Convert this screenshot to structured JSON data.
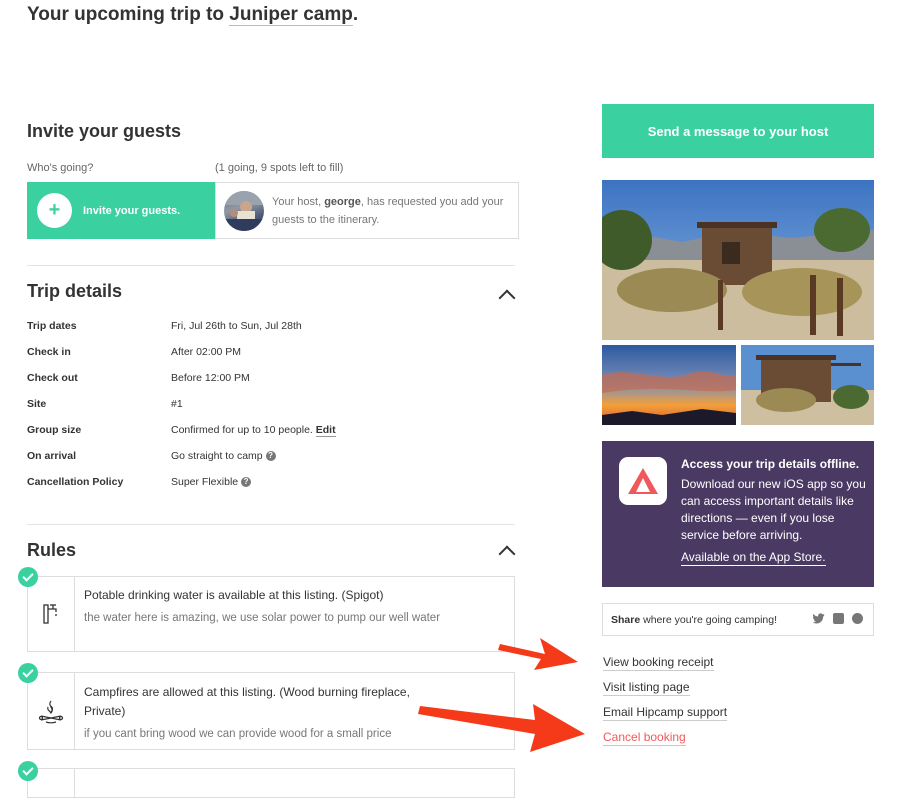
{
  "header": {
    "title_prefix": "Your upcoming trip to ",
    "camp_name": "Juniper camp",
    "title_suffix": "."
  },
  "invite": {
    "heading": "Invite your guests",
    "whos_going_label": "Who's going?",
    "count_text": "(1 going, 9 spots left to fill)",
    "button_label": "Invite your guests.",
    "host_text_pre": "Your host, ",
    "host_name": "george",
    "host_text_post": ", has requested you add your guests to the itinerary."
  },
  "trip_details": {
    "heading": "Trip details",
    "rows": [
      {
        "label": "Trip dates",
        "value": "Fri, Jul 26th to Sun, Jul 28th"
      },
      {
        "label": "Check in",
        "value": "After 02:00 PM"
      },
      {
        "label": "Check out",
        "value": "Before 12:00 PM"
      },
      {
        "label": "Site",
        "value": "#1"
      },
      {
        "label": "Group size",
        "value": "Confirmed for up to 10 people.",
        "link": "Edit"
      },
      {
        "label": "On arrival",
        "value": "Go straight to camp"
      },
      {
        "label": "Cancellation Policy",
        "value": "Super Flexible"
      }
    ]
  },
  "rules": {
    "heading": "Rules",
    "items": [
      {
        "title": "Potable drinking water is available at this listing. (Spigot)",
        "desc": "the water here is amazing, we use solar power to pump our well water",
        "icon": "faucet-icon"
      },
      {
        "title": "Campfires are allowed at this listing. (Wood burning fireplace, Private)",
        "desc": "if you cant bring wood we can provide wood for a small price",
        "icon": "campfire-icon"
      }
    ]
  },
  "sidebar": {
    "message_button": "Send a message to your host",
    "app_promo": {
      "title": "Access your trip details offline.",
      "body": "Download our new iOS app so you can access important details like directions — even if you lose service before arriving.",
      "link": "Available on the App Store."
    },
    "share": {
      "bold": "Share",
      "text": " where you're going camping!"
    },
    "links": [
      "View booking receipt",
      "Visit listing page",
      "Email Hipcamp support",
      "Cancel booking"
    ]
  },
  "colors": {
    "accent": "#3ad0a0",
    "promo_bg": "#4a3a63",
    "danger": "#f0595b",
    "arrow": "#f53a1a"
  }
}
